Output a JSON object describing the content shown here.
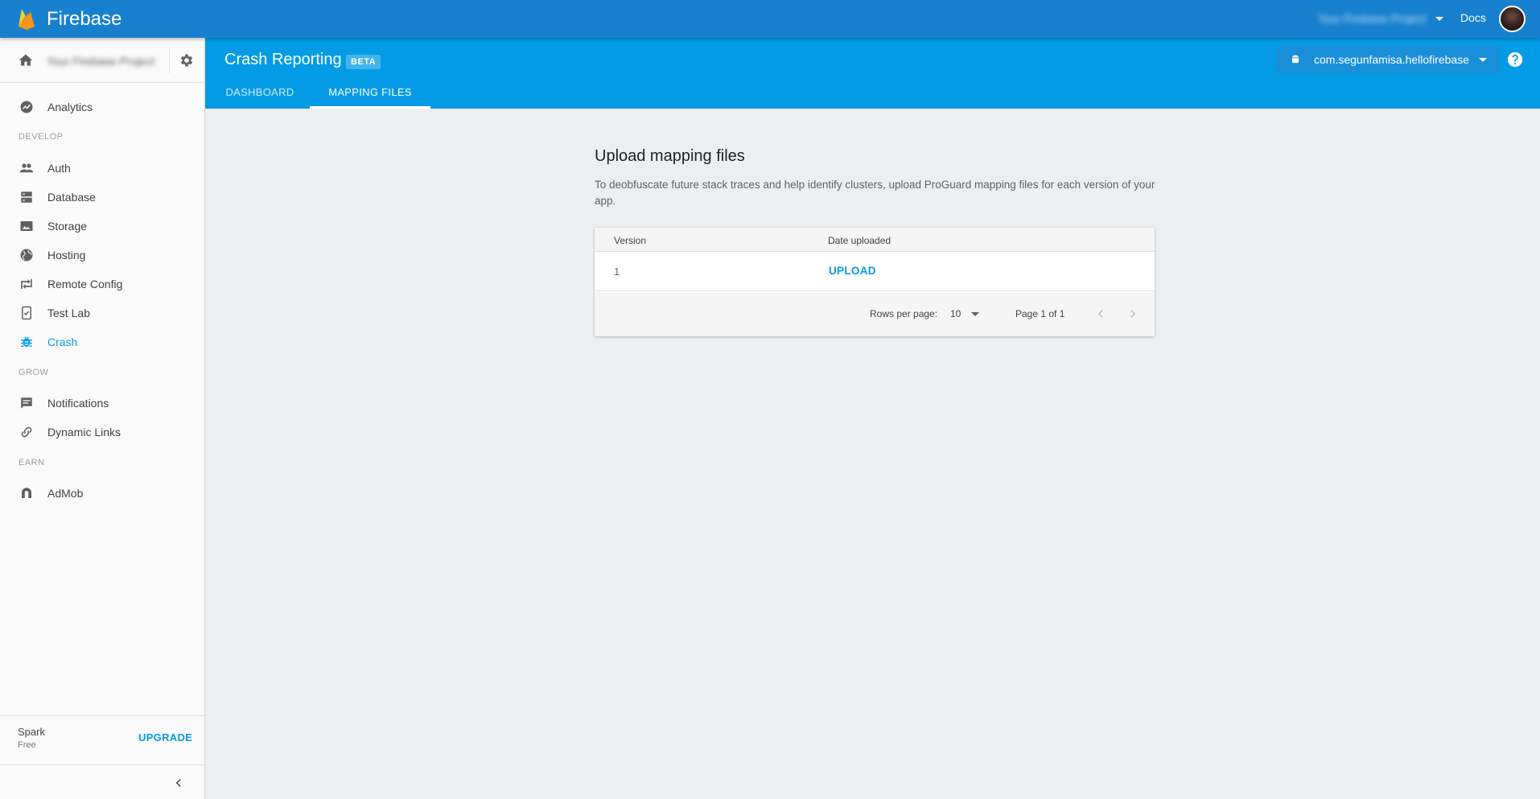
{
  "topbar": {
    "brand": "Firebase",
    "project_name": "Your Firebase Project",
    "docs_label": "Docs"
  },
  "sidebar": {
    "project_name": "Your Firebase Project",
    "items": [
      {
        "label": "Analytics",
        "icon": "analytics-icon"
      },
      {
        "label": "Auth",
        "icon": "people-icon"
      },
      {
        "label": "Database",
        "icon": "database-icon"
      },
      {
        "label": "Storage",
        "icon": "image-icon"
      },
      {
        "label": "Hosting",
        "icon": "globe-icon"
      },
      {
        "label": "Remote Config",
        "icon": "remote-config-icon"
      },
      {
        "label": "Test Lab",
        "icon": "test-lab-icon"
      },
      {
        "label": "Crash",
        "icon": "bug-icon",
        "active": true
      },
      {
        "label": "Notifications",
        "icon": "message-icon"
      },
      {
        "label": "Dynamic Links",
        "icon": "link-icon"
      },
      {
        "label": "AdMob",
        "icon": "admob-icon"
      }
    ],
    "sections": {
      "develop": "DEVELOP",
      "grow": "GROW",
      "earn": "EARN"
    },
    "plan": {
      "name": "Spark",
      "tier": "Free",
      "upgrade_label": "UPGRADE"
    }
  },
  "header": {
    "title": "Crash Reporting",
    "badge": "BETA",
    "app_id": "com.segunfamisa.hellofirebase",
    "tabs": [
      {
        "label": "DASHBOARD",
        "active": false
      },
      {
        "label": "MAPPING FILES",
        "active": true
      }
    ]
  },
  "main": {
    "title": "Upload mapping files",
    "description": "To deobfuscate future stack traces and help identify clusters, upload ProGuard mapping files for each version of your app.",
    "table": {
      "columns": [
        "Version",
        "Date uploaded"
      ],
      "rows": [
        {
          "version": "1",
          "action": "UPLOAD"
        }
      ],
      "rows_per_page_label": "Rows per page:",
      "rows_per_page": "10",
      "page_info": "Page 1 of 1"
    }
  },
  "colors": {
    "topbar": "#1781cf",
    "header": "#039be5",
    "accent": "#039be5",
    "background": "#eceff1"
  }
}
